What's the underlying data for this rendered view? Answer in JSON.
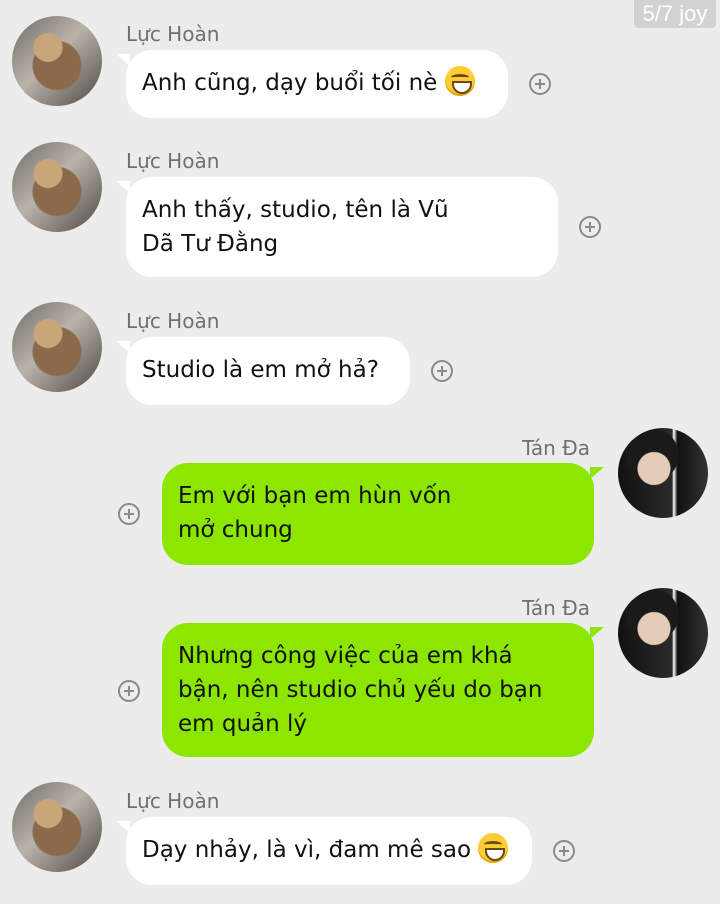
{
  "watermark": "5/7 joy",
  "messages": [
    {
      "sender": "Lực Hoàn",
      "text": "Anh cũng, dạy buổi tối nè",
      "emoji": "grinning-face-emoji"
    },
    {
      "sender": "Lực Hoàn",
      "line1": "Anh thấy, studio, tên là Vũ",
      "line2": "Dã Tư Đằng"
    },
    {
      "sender": "Lực Hoàn",
      "text": "Studio là em mở hả?"
    },
    {
      "sender": "Tán Đa",
      "line1": "Em với bạn em hùn vốn",
      "line2": "mở chung"
    },
    {
      "sender": "Tán Đa",
      "line1": "Nhưng công việc của em khá",
      "line2": "bận, nên studio chủ yếu do bạn",
      "line3": "em quản lý"
    },
    {
      "sender": "Lực Hoàn",
      "text": "Dạy nhảy, là vì, đam mê sao",
      "emoji": "laughing-face-emoji"
    }
  ],
  "colors": {
    "background": "#ececec",
    "incoming_bubble": "#ffffff",
    "outgoing_bubble": "#8de600",
    "sender_name": "#707070"
  },
  "icons": [
    "avatar",
    "add-reaction-icon"
  ]
}
